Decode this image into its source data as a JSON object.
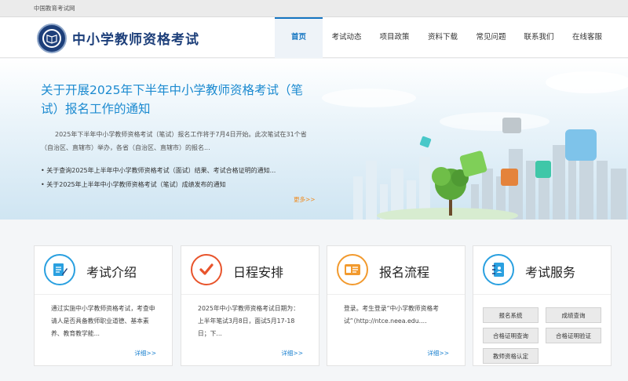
{
  "topbar": {
    "site_link": "中国教育考试网"
  },
  "header": {
    "title": "中小学教师资格考试"
  },
  "nav": [
    {
      "label": "首页",
      "active": true
    },
    {
      "label": "考试动态"
    },
    {
      "label": "项目政策"
    },
    {
      "label": "资料下载"
    },
    {
      "label": "常见问题"
    },
    {
      "label": "联系我们"
    },
    {
      "label": "在线客服"
    }
  ],
  "hero": {
    "title": "关于开展2025年下半年中小学教师资格考试（笔试）报名工作的通知",
    "desc": "2025年下半年中小学教师资格考试（笔试）报名工作将于7月4日开始。此次笔试在31个省（自治区、直辖市）举办，各省（自治区、直辖市）的报名...",
    "links": [
      "• 关于查询2025年上半年中小学教师资格考试（面试）结果、考试合格证明的通知...",
      "• 关于2025年上半年中小学教师资格考试（笔试）成绩发布的通知"
    ],
    "more": "更多>>"
  },
  "cards": [
    {
      "title": "考试介绍",
      "icon": "document-pen-icon",
      "body": "通过实施中小学教师资格考试，考查申请人是否具备教师职业道德、基本素养、教育教学能...",
      "detail": "详细>>"
    },
    {
      "title": "日程安排",
      "icon": "checkmark-icon",
      "body": "2025年中小学教师资格考试日期为：上半年笔试3月8日，面试5月17-18日；下...",
      "detail": "详细>>"
    },
    {
      "title": "报名流程",
      "icon": "id-card-icon",
      "body": "登录。考生登录“中小学教师资格考试”（http://ntce.neea.edu....",
      "detail": "详细>>"
    },
    {
      "title": "考试服务",
      "icon": "notebook-icon"
    }
  ],
  "services": [
    "报名系统",
    "成绩查询",
    "合格证明查询",
    "合格证明验证",
    "教师资格认定"
  ],
  "colors": {
    "brand": "#1d3f7a",
    "accent": "#1575c1",
    "orange": "#f08a1c",
    "icon_blue": "#2aa0e0",
    "icon_red": "#e8542c",
    "icon_orange": "#f29a2e"
  }
}
